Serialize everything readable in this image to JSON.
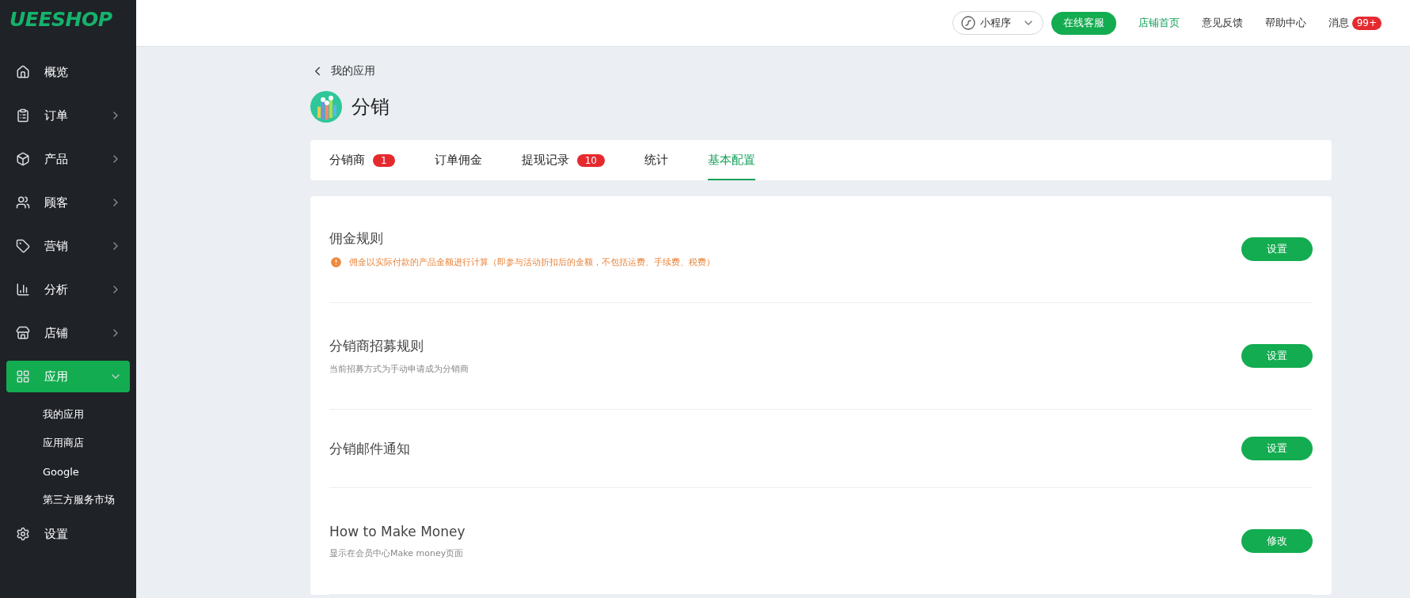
{
  "logo": "UEESHOP",
  "sidebar": {
    "items": [
      {
        "label": "概览",
        "kind": "link",
        "selected": false
      },
      {
        "label": "订单",
        "kind": "group",
        "expanded": false,
        "selected": false
      },
      {
        "label": "产品",
        "kind": "group",
        "expanded": false,
        "selected": false
      },
      {
        "label": "顾客",
        "kind": "group",
        "expanded": false,
        "selected": false
      },
      {
        "label": "营销",
        "kind": "group",
        "expanded": false,
        "selected": false
      },
      {
        "label": "分析",
        "kind": "group",
        "expanded": false,
        "selected": false
      },
      {
        "label": "店铺",
        "kind": "group",
        "expanded": false,
        "selected": false
      },
      {
        "label": "应用",
        "kind": "group",
        "expanded": true,
        "selected": true,
        "children": [
          {
            "label": "我的应用"
          },
          {
            "label": "应用商店"
          },
          {
            "label": "Google"
          },
          {
            "label": "第三方服务市场"
          }
        ]
      },
      {
        "label": "设置",
        "kind": "link",
        "selected": false
      }
    ]
  },
  "topbar": {
    "miniapp": "小程序",
    "service_button": "在线客服",
    "links": [
      {
        "label": "店铺首页",
        "highlighted": true
      },
      {
        "label": "意见反馈",
        "highlighted": false
      },
      {
        "label": "帮助中心",
        "highlighted": false
      }
    ],
    "messages": {
      "label": "消息",
      "badge": "99+"
    }
  },
  "back_link": "我的应用",
  "page_title": "分销",
  "tabs": [
    {
      "label": "分销商",
      "badge": "1",
      "selected": false
    },
    {
      "label": "订单佣金",
      "selected": false
    },
    {
      "label": "提现记录",
      "badge": "10",
      "selected": false
    },
    {
      "label": "统计",
      "selected": false
    },
    {
      "label": "基本配置",
      "selected": true
    }
  ],
  "settings": [
    {
      "title": "佣金规则",
      "note": "佣金以实际付款的产品金额进行计算（即参与活动折扣后的金额，不包括运费、手续费、税费）",
      "kind": "warning",
      "button": "设置"
    },
    {
      "title": "分销商招募规则",
      "note": "当前招募方式为手动申请成为分销商",
      "kind": "plain",
      "button": "设置"
    },
    {
      "title": "分销邮件通知",
      "button": "设置"
    },
    {
      "title": "How to Make Money",
      "note": "显示在会员中心Make money页面",
      "kind": "plain",
      "button": "修改"
    }
  ]
}
